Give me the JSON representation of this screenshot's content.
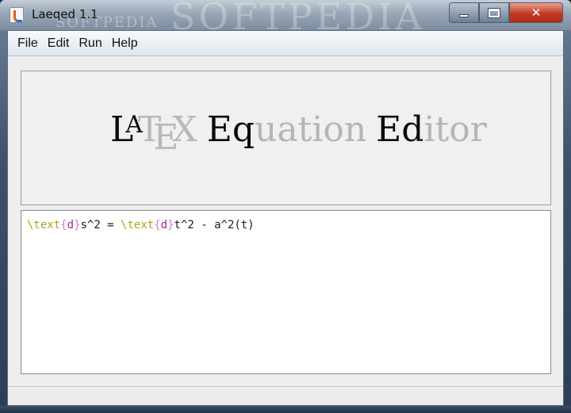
{
  "window": {
    "title": "Laeqed 1.1",
    "watermark": "SOFTPEDIA",
    "watermark_small": "SOFTPEDIA",
    "minimize_label": "",
    "maximize_label": "",
    "close_label": "✕"
  },
  "menubar": {
    "items": [
      "File",
      "Edit",
      "Run",
      "Help"
    ]
  },
  "banner": {
    "latex_L": "L",
    "latex_A": "A",
    "latex_T": "T",
    "latex_E": "E",
    "latex_X": "X",
    "word1_bold": "Eq",
    "word1_light": "uation",
    "word2_bold": "Ed",
    "word2_light": "itor"
  },
  "editor": {
    "tokens": [
      {
        "text": "\\text",
        "kind": "cmd"
      },
      {
        "text": "{",
        "kind": "brace"
      },
      {
        "text": "d",
        "kind": "arg"
      },
      {
        "text": "}",
        "kind": "brace"
      },
      {
        "text": "s^2 = ",
        "kind": "plain"
      },
      {
        "text": "\\text",
        "kind": "cmd"
      },
      {
        "text": "{",
        "kind": "brace"
      },
      {
        "text": "d",
        "kind": "arg"
      },
      {
        "text": "}",
        "kind": "brace"
      },
      {
        "text": "t^2 - a^2(t)",
        "kind": "plain"
      }
    ]
  },
  "colors": {
    "command": "#a7a61c",
    "brace": "#d07ad8",
    "argument": "#a0289c",
    "close_button": "#c23a22"
  }
}
